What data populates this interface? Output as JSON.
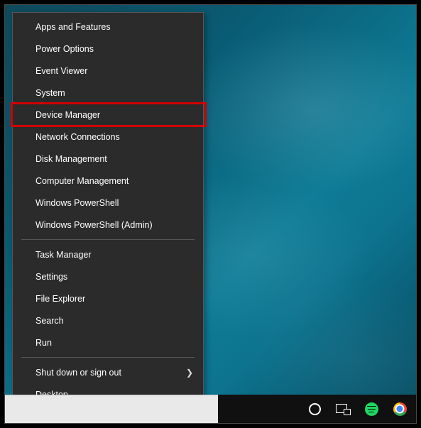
{
  "menu": {
    "groups": [
      {
        "items": [
          {
            "label": "Apps and Features",
            "name": "menu-apps-and-features",
            "submenu": false,
            "highlighted": false
          },
          {
            "label": "Power Options",
            "name": "menu-power-options",
            "submenu": false,
            "highlighted": false
          },
          {
            "label": "Event Viewer",
            "name": "menu-event-viewer",
            "submenu": false,
            "highlighted": false
          },
          {
            "label": "System",
            "name": "menu-system",
            "submenu": false,
            "highlighted": false
          },
          {
            "label": "Device Manager",
            "name": "menu-device-manager",
            "submenu": false,
            "highlighted": true
          },
          {
            "label": "Network Connections",
            "name": "menu-network-connections",
            "submenu": false,
            "highlighted": false
          },
          {
            "label": "Disk Management",
            "name": "menu-disk-management",
            "submenu": false,
            "highlighted": false
          },
          {
            "label": "Computer Management",
            "name": "menu-computer-management",
            "submenu": false,
            "highlighted": false
          },
          {
            "label": "Windows PowerShell",
            "name": "menu-windows-powershell",
            "submenu": false,
            "highlighted": false
          },
          {
            "label": "Windows PowerShell (Admin)",
            "name": "menu-windows-powershell-admin",
            "submenu": false,
            "highlighted": false
          }
        ]
      },
      {
        "items": [
          {
            "label": "Task Manager",
            "name": "menu-task-manager",
            "submenu": false,
            "highlighted": false
          },
          {
            "label": "Settings",
            "name": "menu-settings",
            "submenu": false,
            "highlighted": false
          },
          {
            "label": "File Explorer",
            "name": "menu-file-explorer",
            "submenu": false,
            "highlighted": false
          },
          {
            "label": "Search",
            "name": "menu-search",
            "submenu": false,
            "highlighted": false
          },
          {
            "label": "Run",
            "name": "menu-run",
            "submenu": false,
            "highlighted": false
          }
        ]
      },
      {
        "items": [
          {
            "label": "Shut down or sign out",
            "name": "menu-shutdown-signout",
            "submenu": true,
            "highlighted": false
          },
          {
            "label": "Desktop",
            "name": "menu-desktop",
            "submenu": false,
            "highlighted": false
          }
        ]
      }
    ]
  },
  "taskbar": {
    "icons": [
      {
        "name": "cortana-circle-icon",
        "kind": "circle"
      },
      {
        "name": "task-view-icon",
        "kind": "taskview"
      },
      {
        "name": "spotify-icon",
        "kind": "spotify"
      },
      {
        "name": "chrome-icon",
        "kind": "chrome"
      }
    ]
  },
  "highlight_color": "#d00000"
}
